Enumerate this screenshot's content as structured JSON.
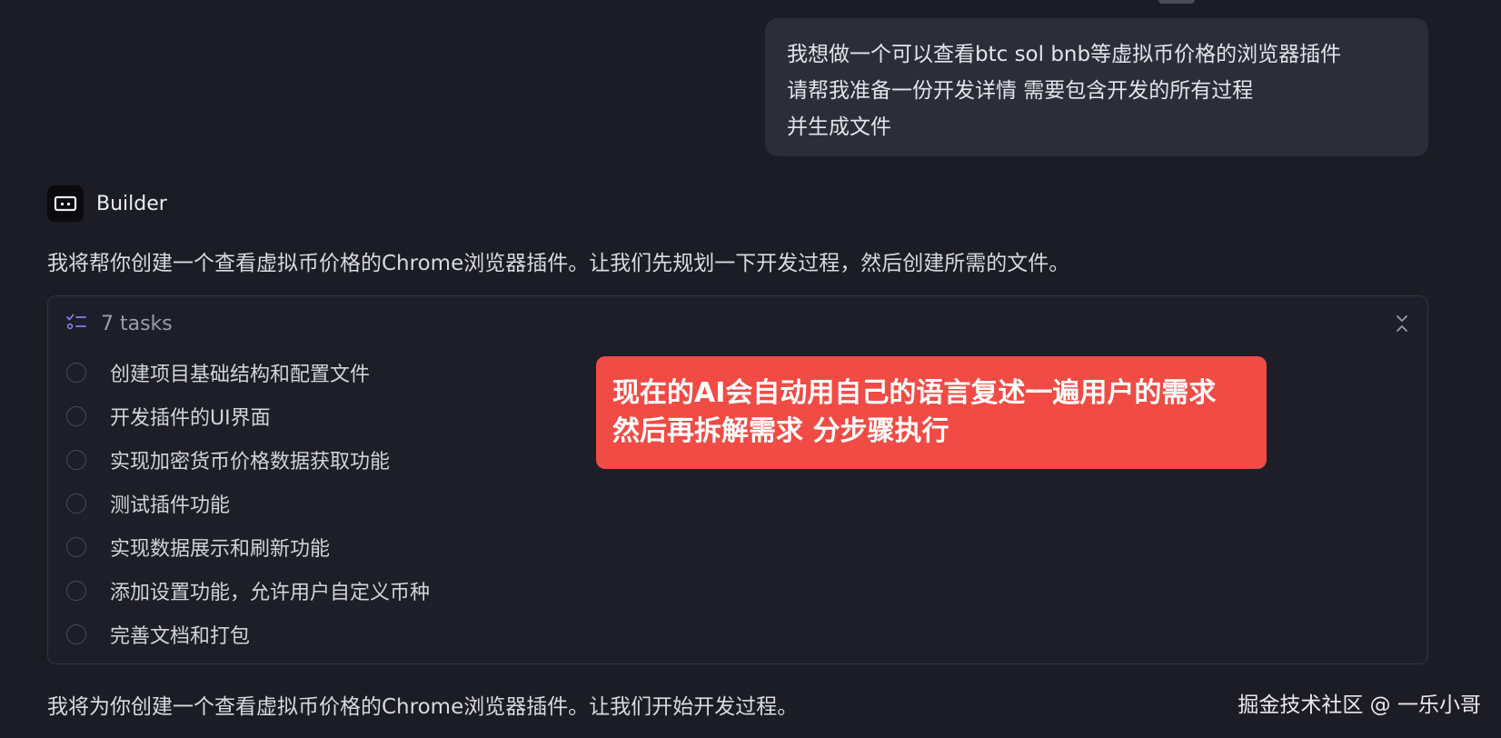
{
  "user_message": {
    "lines": [
      "我想做一个可以查看btc sol bnb等虚拟币价格的浏览器插件",
      "请帮我准备一份开发详情 需要包含开发的所有过程",
      "并生成文件"
    ]
  },
  "assistant": {
    "name": "Builder",
    "avatar_icon": "builder-bot-icon",
    "intro": "我将帮你创建一个查看虚拟币价格的Chrome浏览器插件。让我们先规划一下开发过程，然后创建所需的文件。",
    "closing": "我将为你创建一个查看虚拟币价格的Chrome浏览器插件。让我们开始开发过程。"
  },
  "tasks": {
    "header_icon": "task-list-icon",
    "count_label": "7 tasks",
    "collapse_icon": "collapse-icon",
    "items": [
      {
        "label": "创建项目基础结构和配置文件",
        "done": false
      },
      {
        "label": "开发插件的UI界面",
        "done": false
      },
      {
        "label": "实现加密货币价格数据获取功能",
        "done": false
      },
      {
        "label": "测试插件功能",
        "done": false
      },
      {
        "label": "实现数据展示和刷新功能",
        "done": false
      },
      {
        "label": "添加设置功能，允许用户自定义币种",
        "done": false
      },
      {
        "label": "完善文档和打包",
        "done": false
      }
    ]
  },
  "annotation": {
    "lines": [
      "现在的AI会自动用自己的语言复述一遍用户的需求",
      "然后再拆解需求 分步骤执行"
    ],
    "color": "#f04b44"
  },
  "watermark": "掘金技术社区 @ 一乐小哥",
  "colors": {
    "background": "#1b1c25",
    "bubble": "#2b2d39",
    "accent_icon": "#8b7cf0"
  }
}
